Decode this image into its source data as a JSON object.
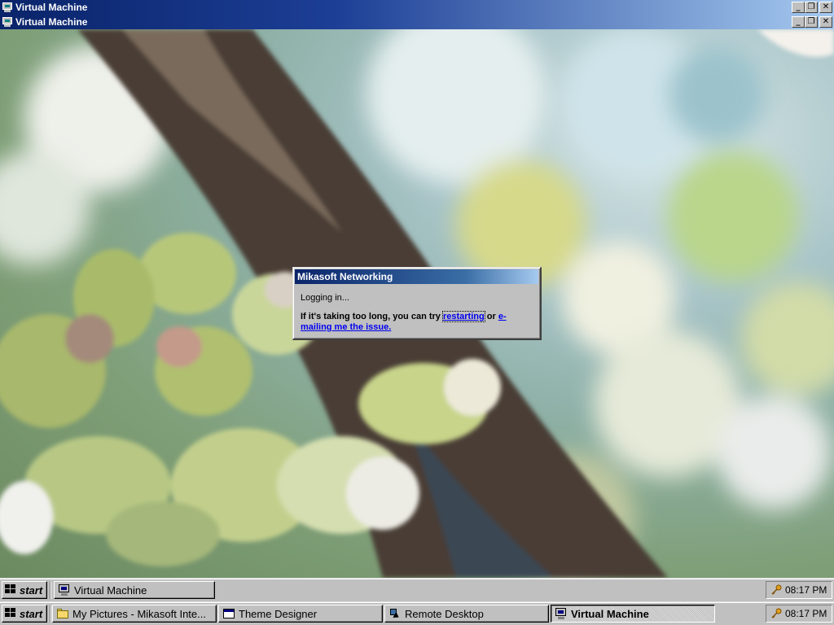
{
  "windows": [
    {
      "title": "Virtual Machine",
      "buttons": {
        "minimize": "_",
        "restore": "❐",
        "close": "✕"
      }
    },
    {
      "title": "Virtual Machine",
      "buttons": {
        "minimize": "_",
        "restore": "❐",
        "close": "✕"
      }
    }
  ],
  "dialog": {
    "title": "Mikasoft Networking",
    "status": "Logging in...",
    "message_prefix": "If it's taking too long, you can try ",
    "link_restart": "restarting",
    "message_mid": " or ",
    "link_email": "e-mailing me the issue."
  },
  "taskbar_inner": {
    "start_label": "start",
    "tasks": [
      {
        "label": "Virtual Machine",
        "icon": "monitor-icon",
        "active": false
      }
    ],
    "clock": "08:17 PM"
  },
  "taskbar_outer": {
    "start_label": "start",
    "tasks": [
      {
        "label": "My Pictures - Mikasoft Inte...",
        "icon": "folder-icon",
        "active": false
      },
      {
        "label": "Theme Designer",
        "icon": "window-icon",
        "active": false
      },
      {
        "label": "Remote Desktop",
        "icon": "remote-desktop-icon",
        "active": false
      },
      {
        "label": "Virtual Machine",
        "icon": "monitor-icon",
        "active": true
      }
    ],
    "clock": "08:17 PM"
  },
  "colors": {
    "titlebar_start": "#0a246a",
    "titlebar_end": "#a6caf0",
    "face": "#c0c0c0",
    "link": "#0000ee"
  }
}
